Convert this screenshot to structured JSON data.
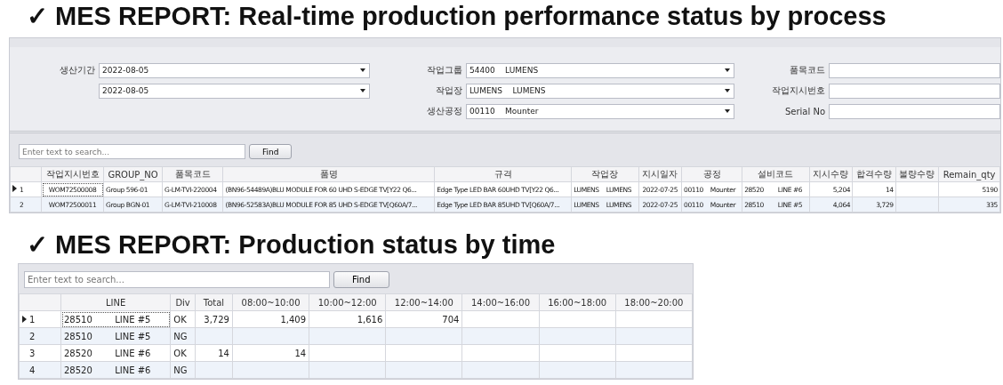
{
  "sections": [
    {
      "title": "✓ MES REPORT: Real-time production performance status by process",
      "filters": {
        "columns": [
          [
            {
              "label": "생산기간",
              "value": "2022-08-05",
              "kind": "dropdown"
            },
            {
              "value": "2022-08-05",
              "kind": "dropdown"
            }
          ],
          [
            {
              "label": "작업그룹",
              "value": "54400    LUMENS",
              "kind": "dropdown"
            },
            {
              "label": "작업장",
              "value": "LUMENS    LUMENS",
              "kind": "dropdown"
            },
            {
              "label": "생산공정",
              "value": "00110    Mounter",
              "kind": "dropdown"
            }
          ],
          [
            {
              "label": "품목코드",
              "kind": "text"
            },
            {
              "label": "작업지시번호",
              "kind": "text"
            },
            {
              "label": "Serial No",
              "kind": "text"
            }
          ]
        ]
      },
      "search": {
        "placeholder": "Enter text to search...",
        "button": "Find"
      },
      "table": {
        "columns": [
          {
            "label": "작업지시번호",
            "kind": "code"
          },
          {
            "label": "GROUP_NO",
            "kind": "text"
          },
          {
            "label": "품목코드",
            "kind": "text"
          },
          {
            "label": "품명",
            "kind": "text"
          },
          {
            "label": "규격",
            "kind": "text"
          },
          {
            "label": "작업장",
            "kind": "text"
          },
          {
            "label": "지시일자",
            "kind": "code"
          },
          {
            "label": "공정",
            "kind": "text"
          },
          {
            "label": "설비코드",
            "kind": "text"
          },
          {
            "label": "지시수량",
            "kind": "number"
          },
          {
            "label": "합격수량",
            "kind": "number"
          },
          {
            "label": "불량수량",
            "kind": "number"
          },
          {
            "label": "Remain_qty",
            "kind": "number"
          }
        ],
        "rows": [
          {
            "number": "1",
            "selected": true,
            "cells": [
              "WOM72500008",
              "Group 596-01",
              "G-LM-TVI-220004",
              "(BN96-54489A)BLU MODULE FOR 60 UHD S-EDGE TV[Y22 Q6...",
              "Edge Type LED BAR 60UHD TV[Y22 Q6...",
              "LUMENS    LUMENS",
              "2022-07-25",
              "00110    Mounter",
              "28520        LINE #6",
              "5,204",
              "14",
              "",
              "5190"
            ]
          },
          {
            "number": "2",
            "selected": false,
            "cells": [
              "WOM72500011",
              "Group BGN-01",
              "G-LM-TVI-210008",
              "(BN96-52583A)BLU MODULE FOR 85 UHD S-EDGE TV[Q60A/7...",
              "Edge Type LED BAR 85UHD TV[Q60A/7...",
              "LUMENS    LUMENS",
              "2022-07-25",
              "00110    Mounter",
              "28510        LINE #5",
              "4,064",
              "3,729",
              "",
              "335"
            ]
          }
        ]
      }
    },
    {
      "title": "✓ MES REPORT: Production status by time",
      "search": {
        "placeholder": "Enter text to search...",
        "button": "Find"
      },
      "table": {
        "columns": [
          {
            "label": "LINE",
            "kind": "text"
          },
          {
            "label": "Div",
            "kind": "text"
          },
          {
            "label": "Total",
            "kind": "number"
          },
          {
            "label": "08:00~10:00",
            "kind": "number"
          },
          {
            "label": "10:00~12:00",
            "kind": "number"
          },
          {
            "label": "12:00~14:00",
            "kind": "number"
          },
          {
            "label": "14:00~16:00",
            "kind": "number"
          },
          {
            "label": "16:00~18:00",
            "kind": "number"
          },
          {
            "label": "18:00~20:00",
            "kind": "number"
          }
        ],
        "rows": [
          {
            "number": "1",
            "selected": true,
            "cells": [
              "28510        LINE #5",
              "OK",
              "3,729",
              "1,409",
              "1,616",
              "704",
              "",
              "",
              ""
            ]
          },
          {
            "number": "2",
            "selected": false,
            "cells": [
              "28510        LINE #5",
              "NG",
              "",
              "",
              "",
              "",
              "",
              "",
              ""
            ]
          },
          {
            "number": "3",
            "selected": false,
            "cells": [
              "28520        LINE #6",
              "OK",
              "14",
              "14",
              "",
              "",
              "",
              "",
              ""
            ]
          },
          {
            "number": "4",
            "selected": false,
            "cells": [
              "28520        LINE #6",
              "NG",
              "",
              "",
              "",
              "",
              "",
              "",
              ""
            ]
          }
        ]
      }
    }
  ]
}
